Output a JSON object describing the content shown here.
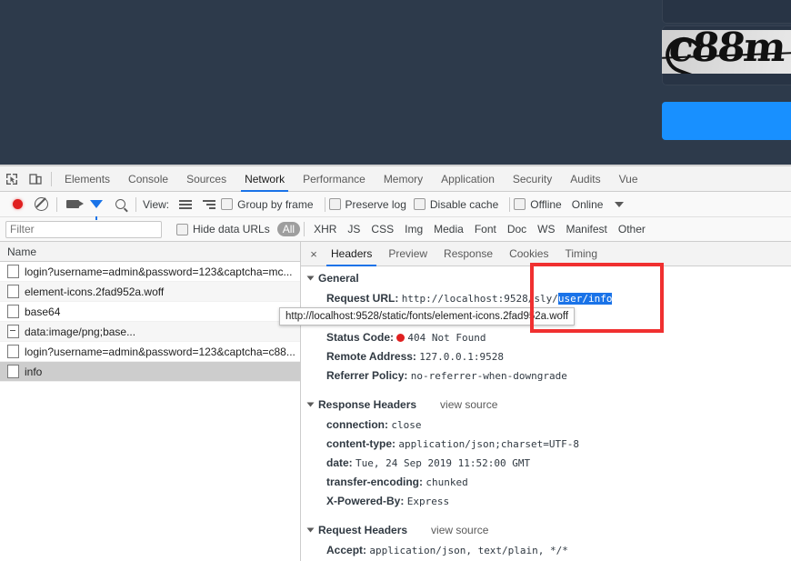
{
  "page": {
    "captcha_text": "c88m",
    "background_color": "#2d3a4b",
    "button_color": "#1890ff"
  },
  "devtools": {
    "icons": {
      "inspect": "inspect-element-icon",
      "device": "device-toolbar-icon"
    },
    "tabs": [
      {
        "label": "Elements",
        "active": false
      },
      {
        "label": "Console",
        "active": false
      },
      {
        "label": "Sources",
        "active": false
      },
      {
        "label": "Network",
        "active": true
      },
      {
        "label": "Performance",
        "active": false
      },
      {
        "label": "Memory",
        "active": false
      },
      {
        "label": "Application",
        "active": false
      },
      {
        "label": "Security",
        "active": false
      },
      {
        "label": "Audits",
        "active": false
      },
      {
        "label": "Vue",
        "active": false
      }
    ],
    "controls": {
      "record_title": "record-button",
      "clear_title": "clear-button",
      "capture_screenshots_title": "camera-icon",
      "filter_title": "filter-icon",
      "search_title": "search-icon",
      "view_label": "View:",
      "group_by_frame": "Group by frame",
      "preserve_log": "Preserve log",
      "disable_cache": "Disable cache",
      "offline": "Offline",
      "throttling": "Online"
    },
    "filterbar": {
      "filter_placeholder": "Filter",
      "hide_data_urls": "Hide data URLs",
      "types": [
        {
          "label": "All",
          "active": true
        },
        {
          "label": "XHR",
          "active": false
        },
        {
          "label": "JS",
          "active": false
        },
        {
          "label": "CSS",
          "active": false
        },
        {
          "label": "Img",
          "active": false
        },
        {
          "label": "Media",
          "active": false
        },
        {
          "label": "Font",
          "active": false
        },
        {
          "label": "Doc",
          "active": false
        },
        {
          "label": "WS",
          "active": false
        },
        {
          "label": "Manifest",
          "active": false
        },
        {
          "label": "Other",
          "active": false
        }
      ]
    },
    "requests": {
      "column_header": "Name",
      "rows": [
        {
          "name": "login?username=admin&password=123&captcha=mc...",
          "icon": "file-icon",
          "selected": false
        },
        {
          "name": "element-icons.2fad952a.woff",
          "icon": "file-icon",
          "selected": false
        },
        {
          "name": "base64",
          "icon": "file-icon",
          "selected": false
        },
        {
          "name": "data:image/png;base...",
          "icon": "file-dash-icon",
          "selected": false
        },
        {
          "name": "login?username=admin&password=123&captcha=c88...",
          "icon": "file-icon",
          "selected": false
        },
        {
          "name": "info",
          "icon": "file-icon",
          "selected": true
        }
      ]
    },
    "detail": {
      "close_label": "×",
      "tabs": [
        {
          "label": "Headers",
          "active": true
        },
        {
          "label": "Preview",
          "active": false
        },
        {
          "label": "Response",
          "active": false
        },
        {
          "label": "Cookies",
          "active": false
        },
        {
          "label": "Timing",
          "active": false
        }
      ],
      "general": {
        "title": "General",
        "request_url_key": "Request URL:",
        "request_url_prefix": "http://localhost:9528/sly/",
        "request_url_highlight": "user/info",
        "status_code_key": "Status Code:",
        "status_code_value": "404 Not Found",
        "remote_address_key": "Remote Address:",
        "remote_address_value": "127.0.0.1:9528",
        "referrer_policy_key": "Referrer Policy:",
        "referrer_policy_value": "no-referrer-when-downgrade"
      },
      "response_headers": {
        "title": "Response Headers",
        "view_source": "view source",
        "items": [
          {
            "key": "connection:",
            "value": "close"
          },
          {
            "key": "content-type:",
            "value": "application/json;charset=UTF-8"
          },
          {
            "key": "date:",
            "value": "Tue, 24 Sep 2019 11:52:00 GMT"
          },
          {
            "key": "transfer-encoding:",
            "value": "chunked"
          },
          {
            "key": "X-Powered-By:",
            "value": "Express"
          }
        ]
      },
      "request_headers": {
        "title": "Request Headers",
        "view_source": "view source",
        "items": [
          {
            "key": "Accept:",
            "value": "application/json, text/plain, */*"
          }
        ]
      }
    },
    "tooltip": {
      "text": "http://localhost:9528/static/fonts/element-icons.2fad952a.woff"
    },
    "annotation": {
      "color": "#f03030"
    }
  }
}
